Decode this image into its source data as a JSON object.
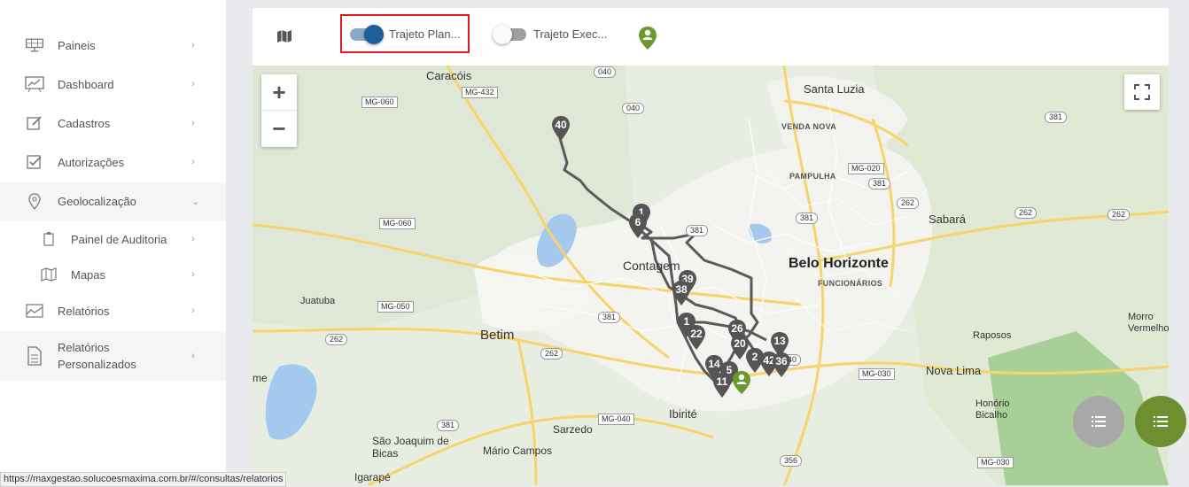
{
  "sidebar": {
    "items": [
      {
        "label": "Paineis",
        "icon": "solar-panel-icon",
        "chevron": "›"
      },
      {
        "label": "Dashboard",
        "icon": "chart-board-icon",
        "chevron": "›"
      },
      {
        "label": "Cadastros",
        "icon": "edit-icon",
        "chevron": "›"
      },
      {
        "label": "Autorizações",
        "icon": "checkbox-icon",
        "chevron": "›"
      },
      {
        "label": "Geolocalização",
        "icon": "location-pin-icon",
        "chevron": "⌄"
      },
      {
        "label": "Painel de Auditoria",
        "icon": "clipboard-icon",
        "chevron": "›"
      },
      {
        "label": "Mapas",
        "icon": "map-icon",
        "chevron": "›"
      },
      {
        "label": "Relatórios",
        "icon": "area-chart-icon",
        "chevron": "›"
      },
      {
        "label": "Relatórios Personalizados",
        "icon": "document-icon",
        "chevron": "›"
      }
    ]
  },
  "toolbar": {
    "map_icon": "map-icon",
    "toggle_planned": {
      "label": "Trajeto Plan...",
      "on": true
    },
    "toggle_executed": {
      "label": "Trajeto Exec...",
      "on": false
    },
    "person_pin_icon": "person-pin-icon"
  },
  "map": {
    "zoom_in": "+",
    "zoom_out": "−",
    "cities": {
      "caracois": "Caracóis",
      "santa_luzia": "Santa Luzia",
      "contagem": "Contagem",
      "belo_horizonte": "Belo Horizonte",
      "betim": "Betim",
      "juatuba": "Juatuba",
      "sabara": "Sabará",
      "ibirite": "Ibirité",
      "sarzedo": "Sarzedo",
      "raposos": "Raposos",
      "nova_lima": "Nova Lima",
      "morro_vermelho": "Morro Vermelho",
      "honorio_bicalho": "Honório Bicalho",
      "sao_joaquim": "São Joaquim de Bicas",
      "mario_campos": "Mário Campos",
      "igarape": "Igarapé",
      "edge_me": "me"
    },
    "districts": {
      "venda_nova": "VENDA NOVA",
      "pampulha": "PAMPULHA",
      "funcionarios": "FUNCIONÁRIOS"
    },
    "roads": [
      "040",
      "MG-432",
      "MG-060",
      "040",
      "MG-020",
      "381",
      "381",
      "381",
      "262",
      "262",
      "MG-060",
      "262",
      "MG-050",
      "381",
      "262",
      "262",
      "040",
      "MG-040",
      "381",
      "MG-030",
      "356",
      "MG-030",
      "381"
    ],
    "markers": [
      "40",
      "1",
      "6",
      "39",
      "38",
      "1",
      "22",
      "26",
      "20",
      "14",
      "5",
      "11",
      "13",
      "42",
      "36",
      "2"
    ]
  },
  "fabs": {
    "left_icon": "list-icon",
    "right_icon": "checklist-icon"
  },
  "status_url": "https://maxgestao.solucoesmaxima.com.br/#/consultas/relatorios"
}
